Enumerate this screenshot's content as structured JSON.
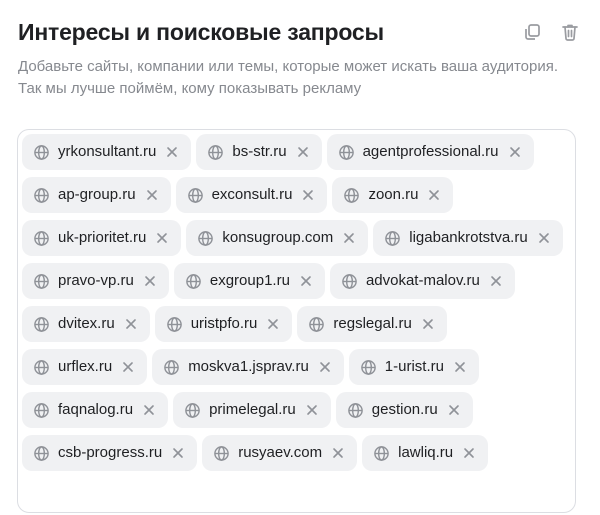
{
  "header": {
    "title": "Интересы и поисковые запросы",
    "copy_icon": "copy-icon",
    "delete_icon": "trash-icon"
  },
  "description": "Добавьте сайты, компании или темы, которые может искать ваша аудитория. Так мы лучше поймём, кому показывать рекламу",
  "chips": [
    "yrkonsultant.ru",
    "bs-str.ru",
    "agentprofessional.ru",
    "ap-group.ru",
    "exconsult.ru",
    "zoon.ru",
    "uk-prioritet.ru",
    "konsugroup.com",
    "ligabankrotstva.ru",
    "pravo-vp.ru",
    "exgroup1.ru",
    "advokat-malov.ru",
    "dvitex.ru",
    "uristpfo.ru",
    "regslegal.ru",
    "urflex.ru",
    "moskva1.jsprav.ru",
    "1-urist.ru",
    "faqnalog.ru",
    "primelegal.ru",
    "gestion.ru",
    "csb-progress.ru",
    "rusyaev.com",
    "lawliq.ru"
  ],
  "colors": {
    "chip_bg": "#f0f1f3",
    "muted_text": "#86898f",
    "icon": "#9a9ca1"
  }
}
